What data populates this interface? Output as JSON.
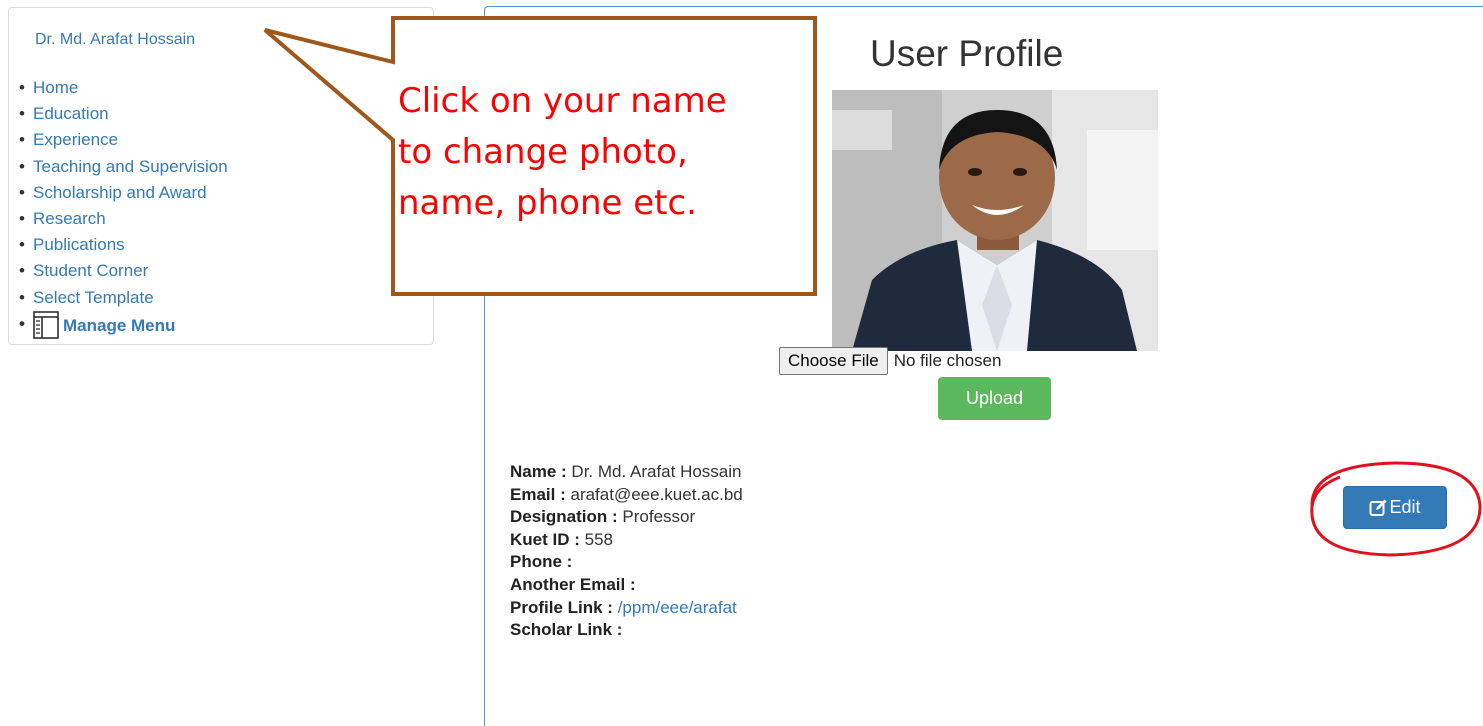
{
  "sidebar": {
    "user_name": "Dr. Md. Arafat Hossain",
    "items": [
      {
        "label": "Home"
      },
      {
        "label": "Education"
      },
      {
        "label": "Experience"
      },
      {
        "label": "Teaching and Supervision"
      },
      {
        "label": "Scholarship and Award"
      },
      {
        "label": "Research"
      },
      {
        "label": "Publications"
      },
      {
        "label": "Student Corner"
      },
      {
        "label": "Select Template"
      },
      {
        "label": "Manage Menu",
        "icon": "menu-document-icon"
      }
    ]
  },
  "main": {
    "title": "User Profile",
    "file_input": {
      "button_label": "Choose File",
      "status": "No file chosen"
    },
    "upload_label": "Upload",
    "edit_label": "Edit",
    "profile": {
      "name_label": "Name :",
      "name": "Dr. Md. Arafat Hossain",
      "email_label": "Email :",
      "email": "arafat@eee.kuet.ac.bd",
      "designation_label": "Designation :",
      "designation": "Professor",
      "kuet_id_label": "Kuet ID :",
      "kuet_id": "558",
      "phone_label": "Phone :",
      "phone": "",
      "another_email_label": "Another Email :",
      "another_email": "",
      "profile_link_label": "Profile Link :",
      "profile_link": "/ppm/eee/arafat",
      "scholar_link_label": "Scholar Link :",
      "scholar_link": ""
    }
  },
  "annotation": {
    "callout_lines": [
      "Click on your name",
      "to change photo,",
      "name, phone etc."
    ]
  },
  "colors": {
    "link": "#337ab7",
    "upload_button": "#5cb85c",
    "edit_button": "#337ab7",
    "annotation_text": "#ff0000",
    "callout_border": "#a0581a",
    "highlight_circle": "#e0101e"
  }
}
